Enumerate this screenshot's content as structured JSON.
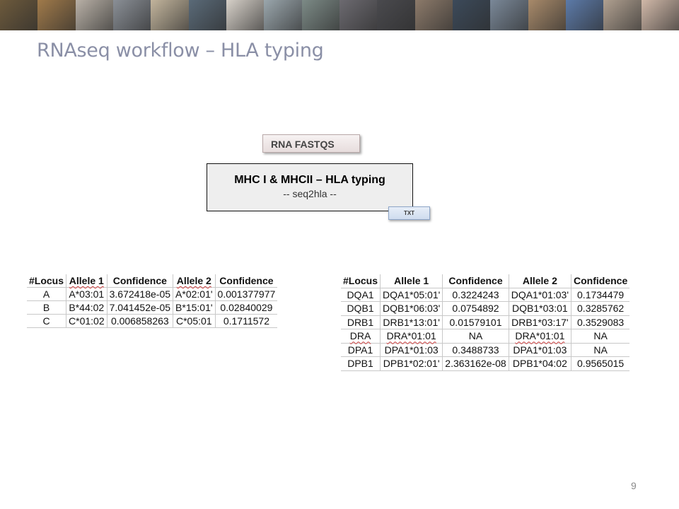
{
  "banner": {
    "tile_colors": [
      "#6d5a3c",
      "#a07a4a",
      "#b8b0a6",
      "#8a8f96",
      "#c2b49c",
      "#5a6a78",
      "#d6d0c8",
      "#9aa6ac",
      "#7c8a86",
      "#6c6a70",
      "#4a4a4e",
      "#8c7a6a",
      "#3c4a5a",
      "#7a8898",
      "#a88a6a",
      "#5c7aa8",
      "#b0a090",
      "#d0b8a8"
    ]
  },
  "slide": {
    "title": "RNAseq workflow – HLA typing",
    "page_number": "9"
  },
  "workflow": {
    "input_label": "RNA FASTQS",
    "tool_title": "MHC I & MHCII – HLA typing",
    "tool_subtitle": "-- seq2hla --",
    "output_label": "TXT"
  },
  "table_mhc1": {
    "headers": [
      "#Locus",
      "Allele 1",
      "Confidence",
      "Allele 2",
      "Confidence"
    ],
    "rows": [
      [
        "A",
        "A*03:01",
        "3.672418e-05",
        "A*02:01'",
        "0.001377977"
      ],
      [
        "B",
        "B*44:02",
        "7.041452e-05",
        "B*15:01'",
        "0.02840029"
      ],
      [
        "C",
        "C*01:02",
        "0.006858263",
        "C*05:01",
        "0.1711572"
      ]
    ]
  },
  "table_mhc2": {
    "headers": [
      "#Locus",
      "Allele 1",
      "Confidence",
      "Allele 2",
      "Confidence"
    ],
    "rows": [
      [
        "DQA1",
        "DQA1*05:01'",
        "0.3224243",
        "DQA1*01:03'",
        "0.1734479"
      ],
      [
        "DQB1",
        "DQB1*06:03'",
        "0.0754892",
        "DQB1*03:01",
        "0.3285762"
      ],
      [
        "DRB1",
        "DRB1*13:01'",
        "0.01579101",
        "DRB1*03:17'",
        "0.3529083"
      ],
      [
        "DRA",
        "DRA*01:01",
        "NA",
        "DRA*01:01",
        "NA"
      ],
      [
        "DPA1",
        "DPA1*01:03",
        "0.3488733",
        "DPA1*01:03",
        "NA"
      ],
      [
        "DPB1",
        "DPB1*02:01'",
        "2.363162e-08",
        "DPB1*04:02",
        "0.9565015"
      ]
    ]
  }
}
